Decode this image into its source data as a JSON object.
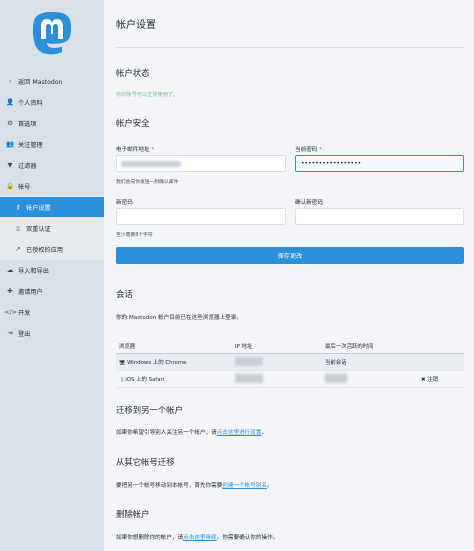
{
  "sidebar": {
    "items": [
      {
        "icon": "chevron-left-icon",
        "glyph": "‹",
        "label": "返回 Mastodon"
      },
      {
        "icon": "user-icon",
        "glyph": "👤",
        "label": "个人资料"
      },
      {
        "icon": "gear-icon",
        "glyph": "⚙",
        "label": "首选项"
      },
      {
        "icon": "users-icon",
        "glyph": "👥",
        "label": "关注管理"
      },
      {
        "icon": "filter-icon",
        "glyph": "▼",
        "label": "过滤器"
      },
      {
        "icon": "lock-icon",
        "glyph": "🔒",
        "label": "帐号"
      },
      {
        "icon": "key-icon",
        "glyph": "⚷",
        "label": "帐户设置"
      },
      {
        "icon": "mobile-icon",
        "glyph": "▯",
        "label": "双重认证"
      },
      {
        "icon": "external-link-icon",
        "glyph": "↗",
        "label": "已授权的应用"
      },
      {
        "icon": "cloud-download-icon",
        "glyph": "☁",
        "label": "导入和导出"
      },
      {
        "icon": "user-plus-icon",
        "glyph": "✚",
        "label": "邀请用户"
      },
      {
        "icon": "code-icon",
        "glyph": "</>",
        "label": "开发"
      },
      {
        "icon": "sign-out-icon",
        "glyph": "⇥",
        "label": "登出"
      }
    ]
  },
  "page": {
    "title": "帐户设置",
    "status_heading": "帐户状态",
    "status_text": "你的帐号可以正常使用了。",
    "security_heading": "帐户安全",
    "email_label": "电子邮件地址",
    "email_hint": "我们会向你发送一封确认邮件",
    "current_password_label": "当前密码",
    "current_password_value": "•••••••••••••••••",
    "new_password_label": "新密码",
    "new_password_hint": "至少需要8个字符",
    "confirm_password_label": "确认新密码",
    "required_mark": "*",
    "save_button": "保存更改",
    "sessions_heading": "会话",
    "sessions_desc": "你的 Mastodon 帐户目前已在这些浏览器上登录。",
    "sessions_table": {
      "headers": [
        "浏览器",
        "IP 地址",
        "最后一次活跃的时间"
      ],
      "rows": [
        {
          "icon": "desktop-icon",
          "glyph": "🖥",
          "browser": "Windows 上的 Chrome",
          "last_active": "当前会话",
          "action": ""
        },
        {
          "icon": "mobile-icon",
          "glyph": "▯",
          "browser": "iOS 上的 Safari",
          "last_active": "",
          "action": "注销"
        }
      ]
    },
    "migrate_to_heading": "迁移到另一个帐户",
    "migrate_to_text": "如果你希望引导别人关注另一个帐户，请",
    "migrate_to_link": "点击这里进行设置",
    "migrate_to_end": "。",
    "migrate_from_heading": "从其它帐号迁移",
    "migrate_from_text": "要把另一个帐号移动到本帐号，首先你需要",
    "migrate_from_link": "创建一个帐号别名",
    "migrate_from_end": "。",
    "delete_heading": "删除帐户",
    "delete_text": "如果你想删除你的帐户，请",
    "delete_link": "点击这里继续",
    "delete_end": "。你需要确认你的操作。"
  },
  "colors": {
    "accent": "#2b90d9",
    "sidebar_bg": "#d9e1e8",
    "success": "#79bd9a",
    "danger": "#df405a"
  }
}
